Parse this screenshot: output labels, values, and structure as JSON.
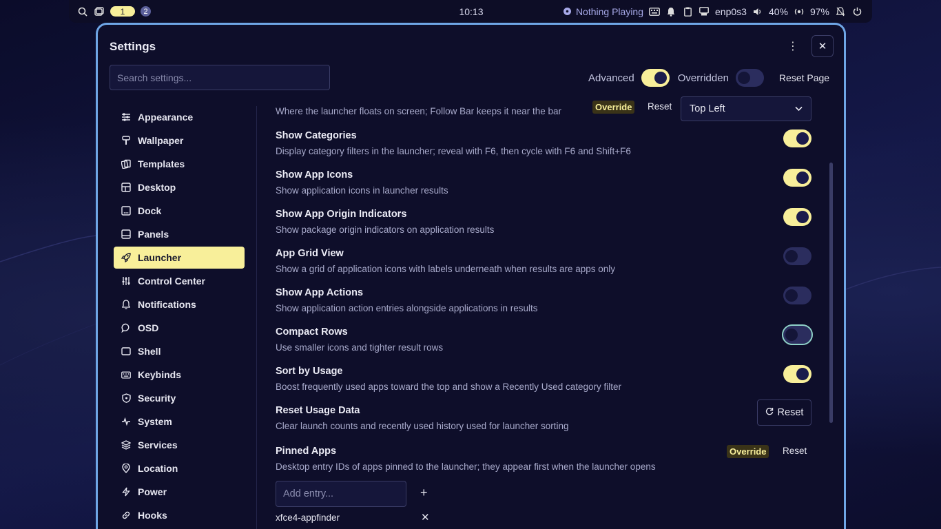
{
  "topbar": {
    "workspace_active": "1",
    "workspace_other": "2",
    "clock": "10:13",
    "media": "Nothing Playing",
    "network": "enp0s3",
    "volume": "40%",
    "brightness": "97%"
  },
  "window": {
    "title": "Settings",
    "search_placeholder": "Search settings...",
    "advanced_label": "Advanced",
    "overridden_label": "Overridden",
    "reset_page_label": "Reset Page"
  },
  "sidebar": {
    "items": [
      {
        "label": "Appearance",
        "icon": "sliders-icon"
      },
      {
        "label": "Wallpaper",
        "icon": "brush-icon"
      },
      {
        "label": "Templates",
        "icon": "template-icon"
      },
      {
        "label": "Desktop",
        "icon": "desktop-icon"
      },
      {
        "label": "Dock",
        "icon": "dock-icon"
      },
      {
        "label": "Panels",
        "icon": "panels-icon"
      },
      {
        "label": "Launcher",
        "icon": "rocket-icon"
      },
      {
        "label": "Control Center",
        "icon": "adjust-icon"
      },
      {
        "label": "Notifications",
        "icon": "bell-icon"
      },
      {
        "label": "OSD",
        "icon": "chat-icon"
      },
      {
        "label": "Shell",
        "icon": "shell-icon"
      },
      {
        "label": "Keybinds",
        "icon": "keyboard-icon"
      },
      {
        "label": "Security",
        "icon": "shield-icon"
      },
      {
        "label": "System",
        "icon": "pulse-icon"
      },
      {
        "label": "Services",
        "icon": "layers-icon"
      },
      {
        "label": "Location",
        "icon": "pin-icon"
      },
      {
        "label": "Power",
        "icon": "bolt-icon"
      },
      {
        "label": "Hooks",
        "icon": "link-icon"
      }
    ],
    "active": "Launcher"
  },
  "content": {
    "position_row": {
      "desc": "Where the launcher floats on screen; Follow Bar keeps it near the bar",
      "override_badge": "Override",
      "reset_label": "Reset",
      "value": "Top Left"
    },
    "settings": [
      {
        "title": "Show Categories",
        "desc": "Display category filters in the launcher; reveal with F6, then cycle with F6 and Shift+F6",
        "enabled": true
      },
      {
        "title": "Show App Icons",
        "desc": "Show application icons in launcher results",
        "enabled": true
      },
      {
        "title": "Show App Origin Indicators",
        "desc": "Show package origin indicators on application results",
        "enabled": true
      },
      {
        "title": "App Grid View",
        "desc": "Show a grid of application icons with labels underneath when results are apps only",
        "enabled": false
      },
      {
        "title": "Show App Actions",
        "desc": "Show application action entries alongside applications in results",
        "enabled": false
      },
      {
        "title": "Compact Rows",
        "desc": "Use smaller icons and tighter result rows",
        "enabled": false
      },
      {
        "title": "Sort by Usage",
        "desc": "Boost frequently used apps toward the top and show a Recently Used category filter",
        "enabled": true
      }
    ],
    "reset_usage": {
      "title": "Reset Usage Data",
      "desc": "Clear launch counts and recently used history used for launcher sorting",
      "button": "Reset"
    },
    "pinned": {
      "title": "Pinned Apps",
      "desc": "Desktop entry IDs of apps pinned to the launcher; they appear first when the launcher opens",
      "override_badge": "Override",
      "reset_label": "Reset",
      "input_placeholder": "Add entry...",
      "add_label": "+",
      "entries": [
        "xfce4-appfinder"
      ]
    }
  },
  "colors": {
    "accent": "#f8ef9a",
    "window_border": "#6fa6e6",
    "background": "#0e0e2a"
  }
}
